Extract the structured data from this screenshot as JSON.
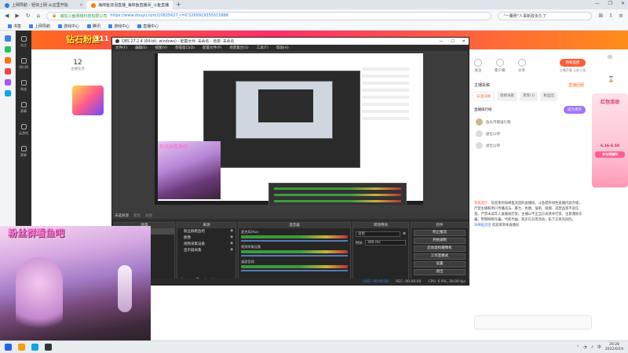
{
  "browser": {
    "tabs": [
      {
        "label": "上网导航 - 轻快上网 从这里开始",
        "active": false
      },
      {
        "label": "海绵鱼流泪直播_海绵鱼直播间_斗鱼直播",
        "active": true
      }
    ],
    "url_site": "诚信斗鱼网络科技有限公司",
    "url_path": "https://www.douyu.com/10825627_r=0.5269919355515886",
    "search": "\"一鹰明\"人事新政永久了",
    "bookmarks": [
      "书签",
      "上网导航",
      "游戏中心",
      "腾讯",
      "游戏中心",
      "直播中心"
    ]
  },
  "left_nav": [
    "关注",
    "排行榜",
    "频道",
    "赛事",
    "云游戏",
    "赛事"
  ],
  "page": {
    "banner_logo": "钻石粉丝",
    "banner_tag": "311",
    "count": "12",
    "count_label": "主播任务"
  },
  "right_panel": {
    "buttons": [
      "关注",
      "客户端",
      "分享"
    ],
    "broadcast_btn": "我要直播",
    "broadcast_sub": "主播开播 立即上线",
    "rank_title": "主播投稿",
    "rank_hl": "直播回顾",
    "tabs": [
      "日送贡献",
      "周榜贡献",
      "贵宾(1)",
      "粉丝团"
    ],
    "chan_title": "直播排行榜",
    "chan_btn": "成为贵宾",
    "users": [
      "鱼丸币赠送礼物",
      "虚位以待",
      "虚位以待"
    ],
    "sys_prefix": "系统提示：",
    "sys_msg": "欢迎来到海绵鱼流泪的直播间。斗鱼倡导绿色直播内容合规，严禁主播和用户传播违法、暴力、色情、低俗、吸烟、违禁品等不良信息。严禁未成年人直播或打赏。主播以不正当方式诱导打赏，注意谨防诈骗，警惕网络诈骗，代练代抽、购买礼包等活动，私下交易有风险。",
    "welcome_user": "海绵鱼流泪",
    "welcome_msg": " 欢迎来到本直播间",
    "promo_title": "红包活动",
    "promo_date": "6.16-6.18",
    "promo_btn": "参与领福利"
  },
  "obs": {
    "title": "OBS 27.2.4 (64-bit, windows) - 配置文件: 未命名 - 场景: 未命名",
    "menu": [
      "文件(F)",
      "编辑(E)",
      "视图(V)",
      "停靠窗口(D)",
      "配置文件(P)",
      "场景集合(S)",
      "工具(T)",
      "帮助(H)"
    ],
    "preview_caption": "粉丝群看鱼吧",
    "dock_header": [
      "未选择源",
      "属性",
      "滤镜"
    ],
    "panels": {
      "scenes": "场景",
      "sources": "来源",
      "mixer": "混音器",
      "transitions": "转场特效",
      "controls": "控件"
    },
    "scene_item": "场景",
    "sources": [
      "粉丝群看鱼吧",
      "图像",
      "视频采集设备",
      "显示器采集"
    ],
    "mixer_items": [
      {
        "name": "麦克风/Aux",
        "db": "0.0 dB"
      },
      {
        "name": "视频采集设备",
        "db": "0.0 dB"
      },
      {
        "name": "桌面音频",
        "db": "0.0 dB"
      }
    ],
    "transition": "淡化",
    "duration_label": "时长",
    "duration": "300 ms",
    "controls": [
      "停止推流",
      "开始录制",
      "启动虚拟摄像机",
      "工作室模式",
      "设置",
      "退出"
    ],
    "status": [
      "LIVE: 00:00:00",
      "REC: 00:00:00",
      "CPU: 0.9%, 30.00 fps"
    ]
  },
  "overlay_caption": "粉丝群看鱼吧",
  "taskbar": {
    "time": "20:28",
    "date": "2022/6/19",
    "lang": "中"
  }
}
